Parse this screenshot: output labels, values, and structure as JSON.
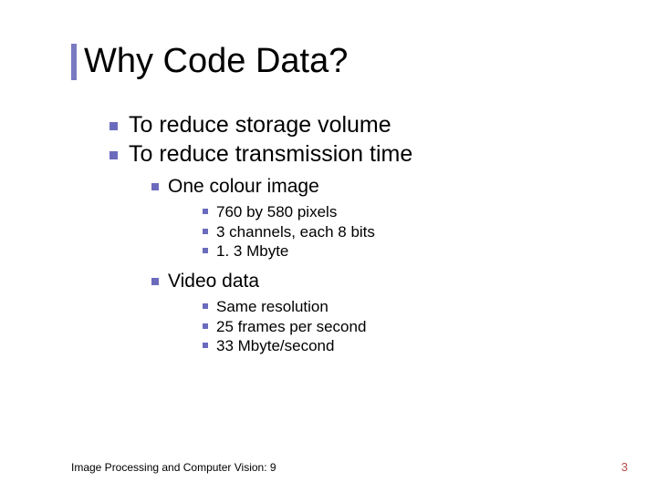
{
  "title": "Why Code Data?",
  "bullets_l1": {
    "0": "To reduce storage volume",
    "1": "To reduce transmission time"
  },
  "bullets_l2": {
    "0": "One colour image",
    "1": "Video data"
  },
  "bullets_l3a": {
    "0": "760 by 580 pixels",
    "1": "3 channels, each 8 bits",
    "2": "1. 3 Mbyte"
  },
  "bullets_l3b": {
    "0": "Same resolution",
    "1": "25 frames per second",
    "2": "33 Mbyte/second"
  },
  "footer": {
    "left": "Image Processing and Computer Vision: 9",
    "right": "3"
  }
}
